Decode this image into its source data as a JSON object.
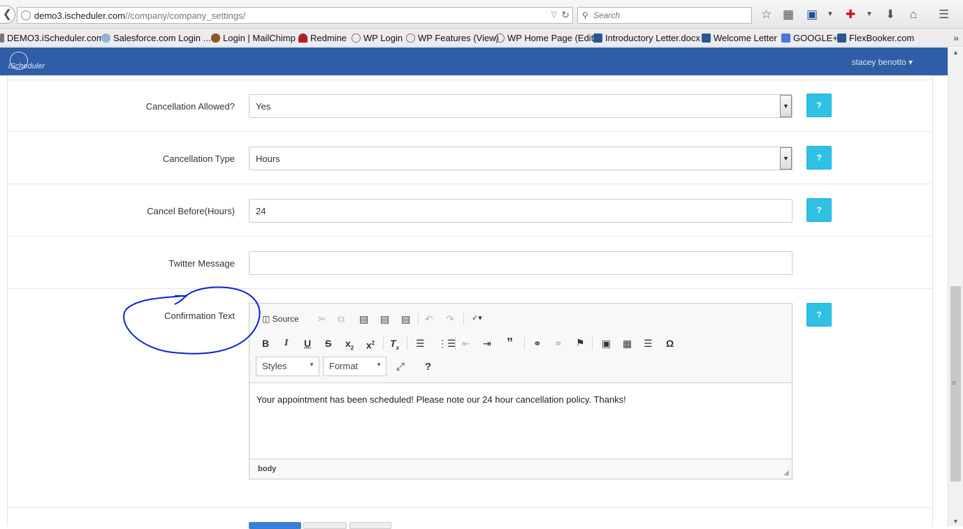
{
  "browser": {
    "url_host": "demo3.ischeduler.com",
    "url_path": "//company/company_settings/",
    "search_placeholder": "Search"
  },
  "bookmarks": [
    {
      "label": "DEMO3.iScheduler.com",
      "icon_color": "#777777"
    },
    {
      "label": "Salesforce.com Login ...",
      "icon_color": "#8fb4d8"
    },
    {
      "label": "Login | MailChimp",
      "icon_color": "#8b5a2b"
    },
    {
      "label": "Redmine",
      "icon_color": "#b22222"
    },
    {
      "label": "WP Login",
      "icon_color": "#777777"
    },
    {
      "label": "WP Features (View)",
      "icon_color": "#777777"
    },
    {
      "label": "WP Home Page (Edit)",
      "icon_color": "#777777"
    },
    {
      "label": "Introductory Letter.docx",
      "icon_color": "#2b5797"
    },
    {
      "label": "Welcome Letter",
      "icon_color": "#2b5797"
    },
    {
      "label": "GOOGLE+",
      "icon_color": "#4a78d9"
    },
    {
      "label": "FlexBooker.com",
      "icon_color": "#2b5797"
    }
  ],
  "header": {
    "logo_text": "iScheduler",
    "user_name": "stacey benotto",
    "bg_color": "#2f5ea7"
  },
  "form": {
    "cancellation_allowed": {
      "label": "Cancellation Allowed?",
      "value": "Yes",
      "help": "?"
    },
    "cancellation_type": {
      "label": "Cancellation Type",
      "value": "Hours",
      "help": "?"
    },
    "cancel_before": {
      "label": "Cancel Before(Hours)",
      "value": "24",
      "help": "?"
    },
    "twitter_message": {
      "label": "Twitter Message",
      "value": ""
    },
    "confirmation_text": {
      "label": "Confirmation Text",
      "help": "?"
    }
  },
  "editor": {
    "source_label": "Source",
    "styles_label": "Styles",
    "format_label": "Format",
    "content": "Your appointment has been scheduled! Please note our 24 hour cancellation policy. Thanks!",
    "path": "body"
  },
  "help_color": "#2fc0e5",
  "annotation_color": "#0a1fd6"
}
